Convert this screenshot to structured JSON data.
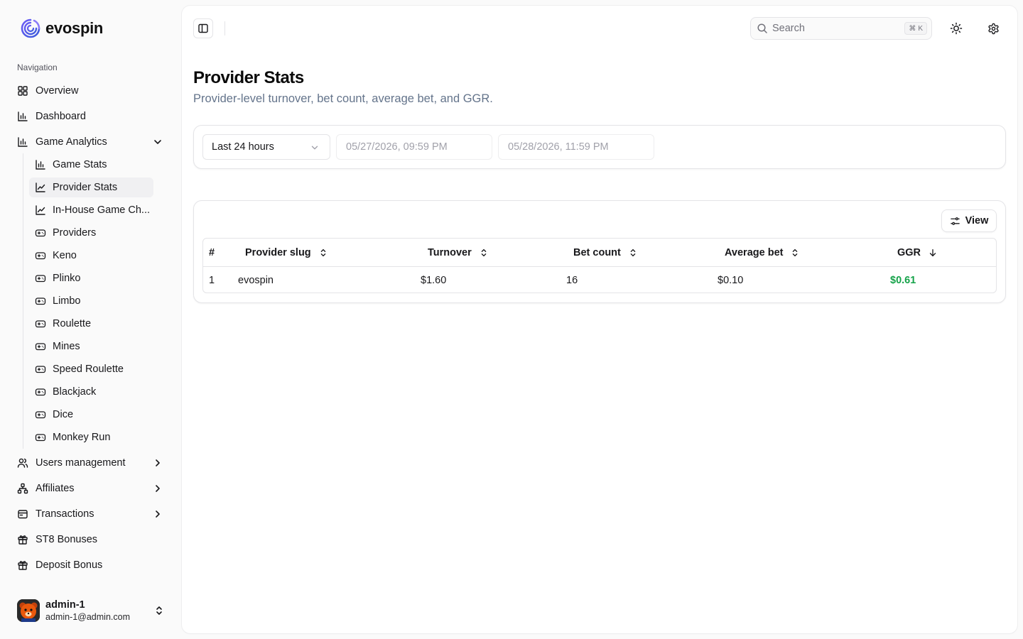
{
  "brand": {
    "name": "evospin"
  },
  "sidebar": {
    "heading": "Navigation",
    "items_top": [
      {
        "label": "Overview",
        "icon": "grid-icon"
      },
      {
        "label": "Dashboard",
        "icon": "bar-chart-icon"
      },
      {
        "label": "Game Analytics",
        "icon": "bar-chart-icon",
        "expanded": true
      }
    ],
    "sub_items": [
      {
        "label": "Game Stats",
        "icon": "bar-chart-icon"
      },
      {
        "label": "Provider Stats",
        "icon": "line-chart-icon",
        "active": true
      },
      {
        "label": "In-House Game Ch...",
        "icon": "line-chart-icon"
      },
      {
        "label": "Providers",
        "icon": "gamepad-icon"
      },
      {
        "label": "Keno",
        "icon": "gamepad-icon"
      },
      {
        "label": "Plinko",
        "icon": "gamepad-icon"
      },
      {
        "label": "Limbo",
        "icon": "gamepad-icon"
      },
      {
        "label": "Roulette",
        "icon": "gamepad-icon"
      },
      {
        "label": "Mines",
        "icon": "gamepad-icon"
      },
      {
        "label": "Speed Roulette",
        "icon": "gamepad-icon"
      },
      {
        "label": "Blackjack",
        "icon": "gamepad-icon"
      },
      {
        "label": "Dice",
        "icon": "gamepad-icon"
      },
      {
        "label": "Monkey Run",
        "icon": "gamepad-icon"
      }
    ],
    "items_bottom": [
      {
        "label": "Users management",
        "icon": "users-icon",
        "has_children": true
      },
      {
        "label": "Affiliates",
        "icon": "network-icon",
        "has_children": true
      },
      {
        "label": "Transactions",
        "icon": "wallet-icon",
        "has_children": true
      },
      {
        "label": "ST8 Bonuses",
        "icon": "gift-icon"
      },
      {
        "label": "Deposit Bonus",
        "icon": "gift-icon"
      }
    ],
    "user": {
      "name": "admin-1",
      "email": "admin-1@admin.com"
    }
  },
  "header": {
    "search_placeholder": "Search",
    "shortcut_symbol": "⌘",
    "shortcut_key": "K"
  },
  "page": {
    "title": "Provider Stats",
    "subtitle": "Provider-level turnover, bet count, average bet, and GGR."
  },
  "filters": {
    "range": "Last 24 hours",
    "start": "05/27/2026, 09:59 PM",
    "end": "05/28/2026, 11:59 PM"
  },
  "table": {
    "view_label": "View",
    "columns": [
      "#",
      "Provider slug",
      "Turnover",
      "Bet count",
      "Average bet",
      "GGR"
    ],
    "sorted_column": "GGR",
    "sort_direction": "desc",
    "rows": [
      [
        "1",
        "evospin",
        "$1.60",
        "16",
        "$0.10",
        "$0.61"
      ]
    ]
  },
  "colors": {
    "accent": "#4f46e5",
    "positive": "#16a34a",
    "muted": "#64748b"
  }
}
